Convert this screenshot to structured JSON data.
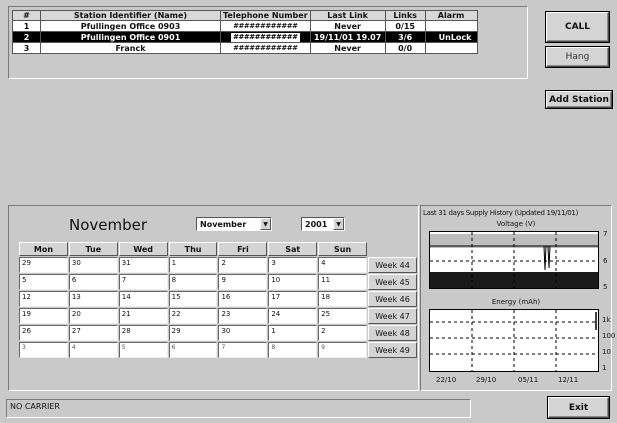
{
  "stations": {
    "headers": [
      "#",
      "Station Identifier (Name)",
      "Telephone Number",
      "Last Link",
      "Links",
      "Alarm"
    ],
    "rows": [
      {
        "num": "1",
        "name": "Pfullingen Office 0903",
        "phone": "############",
        "last_link": "Never",
        "links": "0/15",
        "alarm": ""
      },
      {
        "num": "2",
        "name": "Pfullingen Office 0901",
        "phone": "############",
        "last_link": "19/11/01 19.07",
        "links": "3/6",
        "alarm": "UnLock"
      },
      {
        "num": "3",
        "name": "Franck",
        "phone": "############",
        "last_link": "Never",
        "links": "0/0",
        "alarm": ""
      }
    ]
  },
  "buttons": {
    "call": "CALL",
    "hang": "Hang",
    "add_station": "Add Station",
    "exit": "Exit"
  },
  "calendar": {
    "month_title": "November",
    "month_select": "November",
    "year_select": "2001",
    "days": [
      "Mon",
      "Tue",
      "Wed",
      "Thu",
      "Fri",
      "Sat",
      "Sun"
    ],
    "weeks": [
      {
        "label": "Week 44",
        "dates": [
          "29",
          "30",
          "31",
          "1",
          "2",
          "3",
          "4"
        ]
      },
      {
        "label": "Week 45",
        "dates": [
          "5",
          "6",
          "7",
          "8",
          "9",
          "10",
          "11"
        ]
      },
      {
        "label": "Week 46",
        "dates": [
          "12",
          "13",
          "14",
          "15",
          "16",
          "17",
          "18"
        ]
      },
      {
        "label": "Week 47",
        "dates": [
          "19",
          "20",
          "21",
          "22",
          "23",
          "24",
          "25"
        ]
      },
      {
        "label": "Week 48",
        "dates": [
          "26",
          "27",
          "28",
          "29",
          "30",
          "1",
          "2"
        ]
      },
      {
        "label": "Week 49",
        "dates": [
          "3",
          "4",
          "5",
          "6",
          "7",
          "8",
          "9"
        ]
      }
    ]
  },
  "history": {
    "title": "Last 31 days Supply History (Updated 19/11/01)",
    "voltage_label": "Voltage (V)",
    "voltage_ticks": [
      "7",
      "6",
      "5"
    ],
    "energy_label": "Energy (mAh)",
    "energy_ticks": [
      "1k",
      "100",
      "10",
      "1"
    ],
    "date_ticks": [
      "22/10",
      "29/10",
      "05/11",
      "12/11"
    ]
  },
  "status": {
    "text": "NO CARRIER"
  },
  "colors": {
    "background": "#c9c9c9",
    "selected_row": "#000000",
    "chart_fill": "#1a1a1a"
  }
}
